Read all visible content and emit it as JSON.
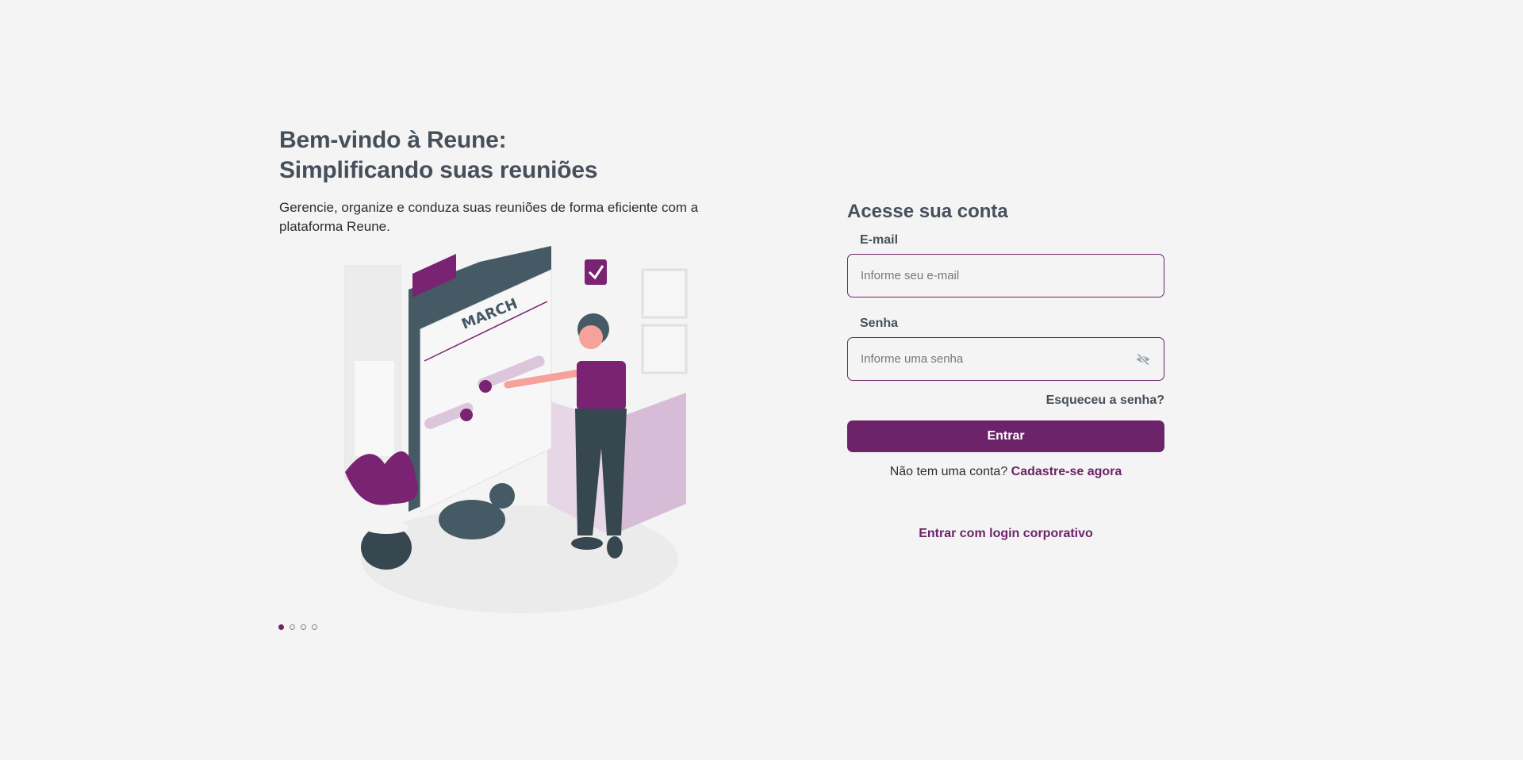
{
  "hero": {
    "title_line1": "Bem-vindo à Reune:",
    "title_line2": "Simplificando suas reuniões",
    "description": "Gerencie, organize e conduza suas reuniões de forma eficiente com a plataforma Reune.",
    "illustration_lettering": "MARCH"
  },
  "carousel": {
    "count": 4,
    "active": 1
  },
  "login": {
    "title": "Acesse sua conta",
    "email_label": "E-mail",
    "email_placeholder": "Informe seu e-mail",
    "email_value": "",
    "password_label": "Senha",
    "password_placeholder": "Informe uma senha",
    "password_value": "",
    "forgot_label": "Esqueceu a senha?",
    "submit_label": "Entrar",
    "no_account_text": "Não tem uma conta?",
    "signup_link": "Cadastre-se agora",
    "corporate_link": "Entrar com login corporativo"
  },
  "colors": {
    "brand": "#6d2369",
    "text": "#464f5a",
    "background": "#f4f4f4"
  }
}
